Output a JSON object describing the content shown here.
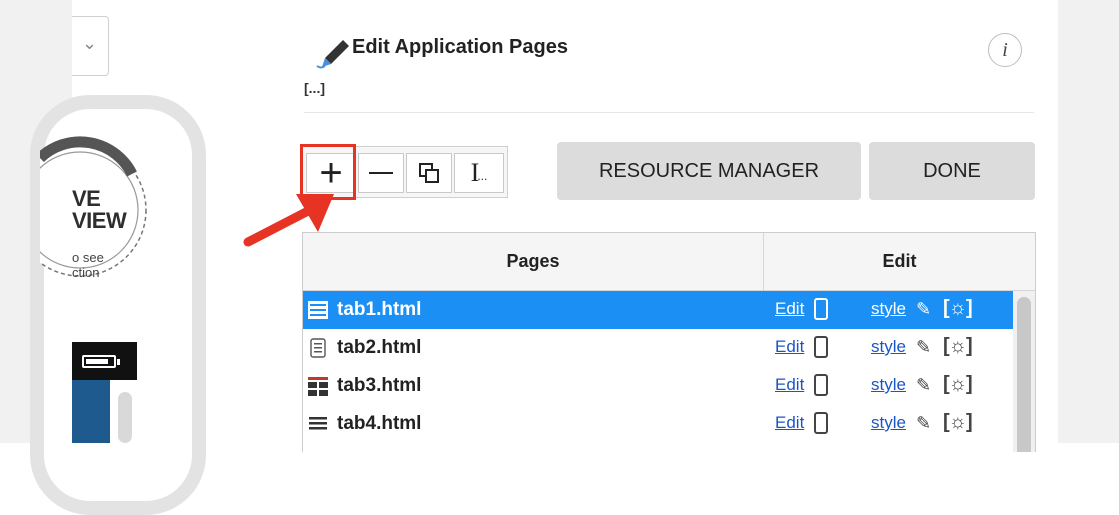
{
  "header": {
    "title": "Edit Application Pages",
    "ellipsis": "[...]",
    "info_label": "i"
  },
  "preview": {
    "seal_line1": "VE",
    "seal_line2": "VIEW",
    "seal_line3": "o see",
    "seal_line4": "ction"
  },
  "toolbar": {
    "add_label": "+",
    "rename_label": "I",
    "rename_suffix": "..."
  },
  "buttons": {
    "resource_manager": "RESOURCE MANAGER",
    "done": "DONE"
  },
  "table": {
    "headers": {
      "pages": "Pages",
      "edit": "Edit"
    },
    "rows": [
      {
        "name": "tab1.html",
        "edit_label": "Edit",
        "style_label": "style",
        "gear_label": "[☼]",
        "icon": "list-icon",
        "selected": true
      },
      {
        "name": "tab2.html",
        "edit_label": "Edit",
        "style_label": "style",
        "gear_label": "[☼]",
        "icon": "document-icon",
        "selected": false
      },
      {
        "name": "tab3.html",
        "edit_label": "Edit",
        "style_label": "style",
        "gear_label": "[☼]",
        "icon": "grid-icon",
        "selected": false
      },
      {
        "name": "tab4.html",
        "edit_label": "Edit",
        "style_label": "style",
        "gear_label": "[☼]",
        "icon": "list-icon",
        "selected": false
      }
    ]
  },
  "colors": {
    "accent": "#1b8ff4",
    "highlight": "#e63323",
    "link": "#1a55c8"
  }
}
